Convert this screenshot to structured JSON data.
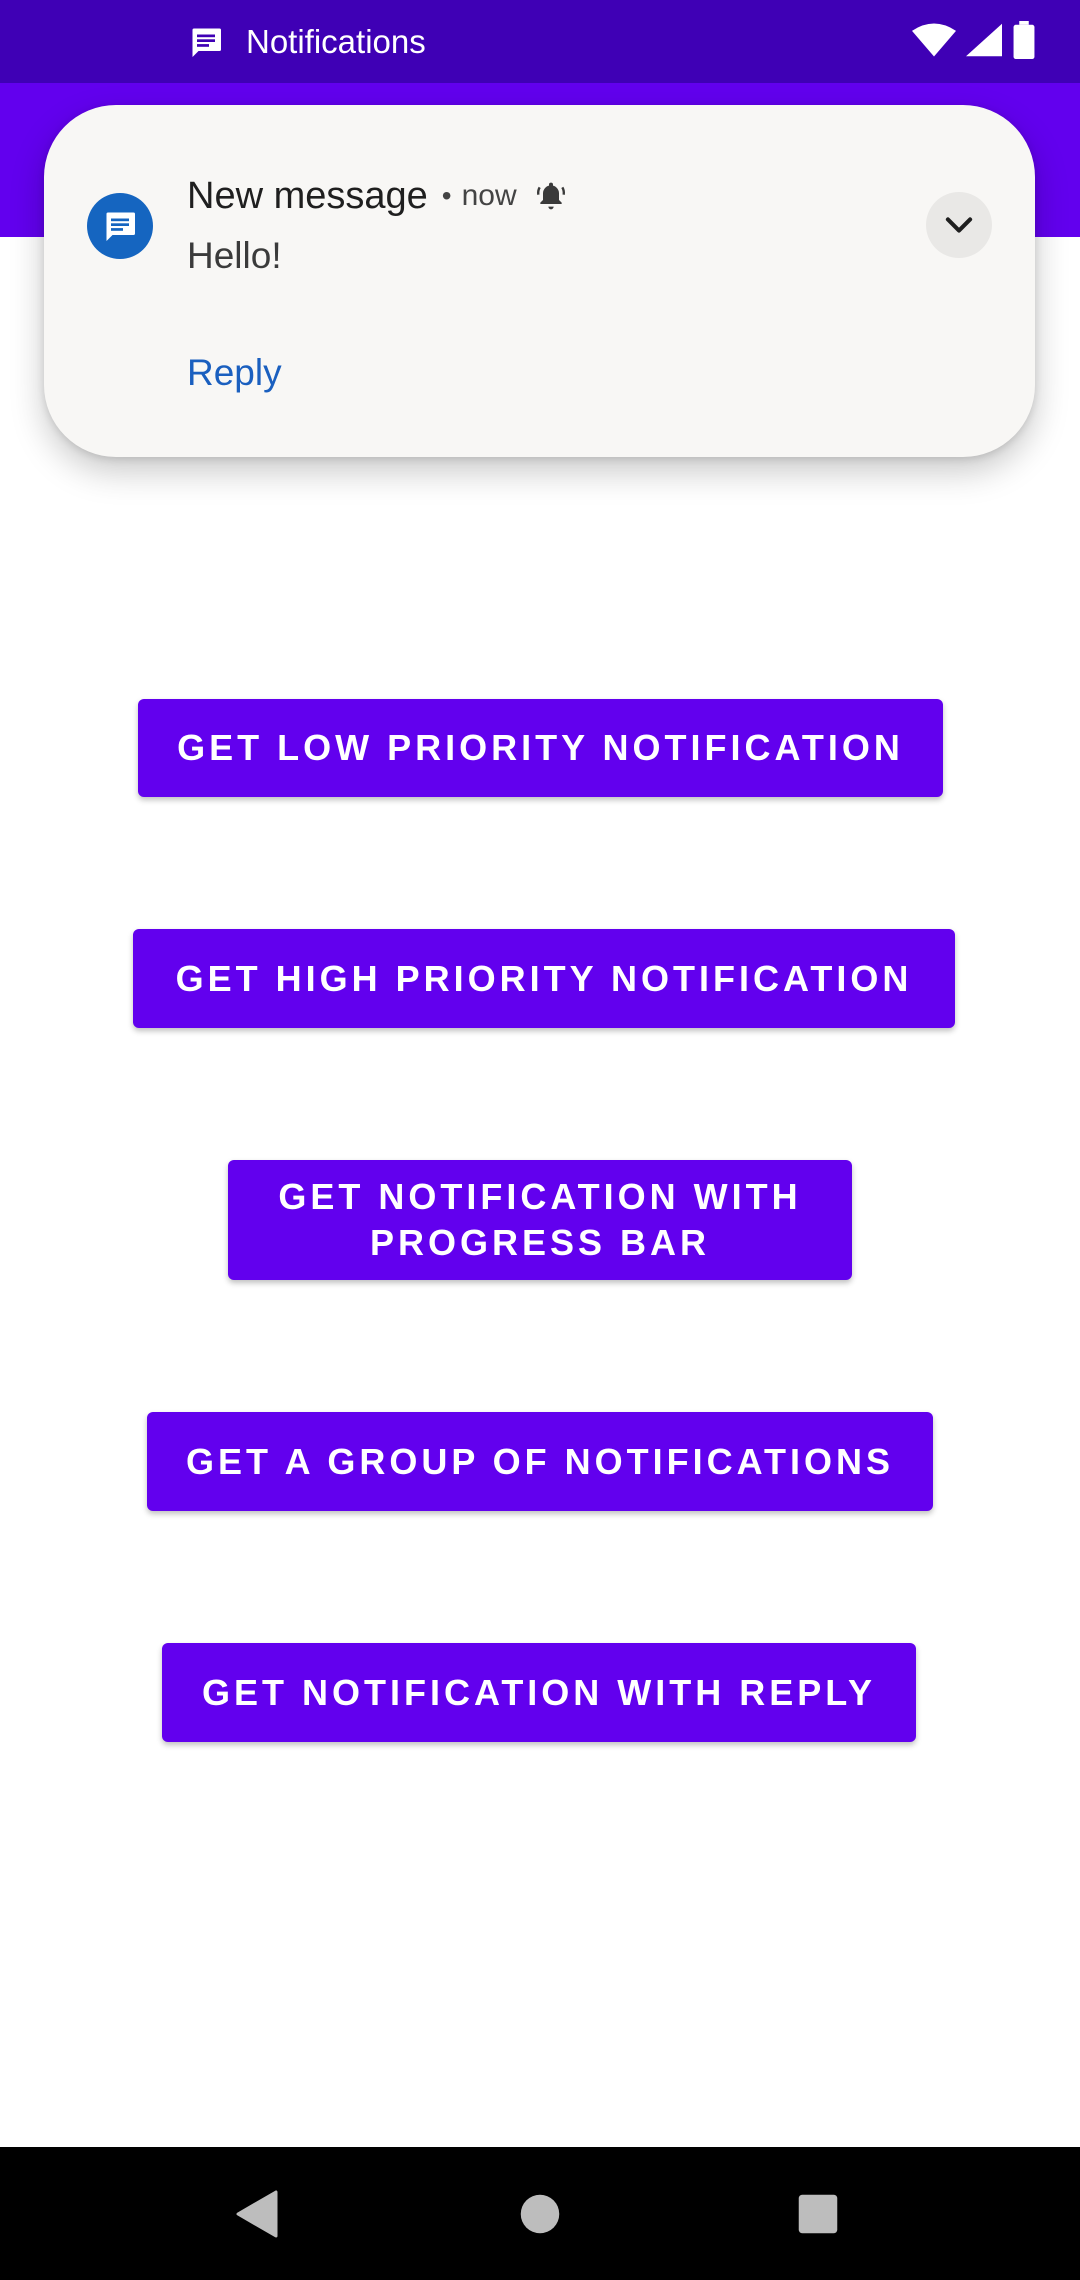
{
  "status_bar": {
    "title": "Notifications",
    "icons": [
      "message-icon",
      "wifi-icon",
      "cell-signal-icon",
      "battery-icon"
    ],
    "background": "#3f00b5"
  },
  "app_bar": {
    "background": "#6200ee"
  },
  "notification": {
    "app_icon": "message-icon",
    "title": "New message",
    "separator": "•",
    "time": "now",
    "alert_icon": "bell-icon",
    "text": "Hello!",
    "action_label": "Reply",
    "expand_icon": "chevron-down-icon",
    "accent": "#1a5fbf"
  },
  "buttons": [
    {
      "label": "GET LOW PRIORITY NOTIFICATION"
    },
    {
      "label": "GET HIGH PRIORITY NOTIFICATION"
    },
    {
      "label": "GET NOTIFICATION WITH PROGRESS BAR"
    },
    {
      "label": "GET A GROUP OF NOTIFICATIONS"
    },
    {
      "label": "GET NOTIFICATION WITH REPLY"
    }
  ],
  "button_color": "#6200ee",
  "nav_bar": {
    "icons": [
      "back-icon",
      "home-icon",
      "recents-icon"
    ]
  }
}
